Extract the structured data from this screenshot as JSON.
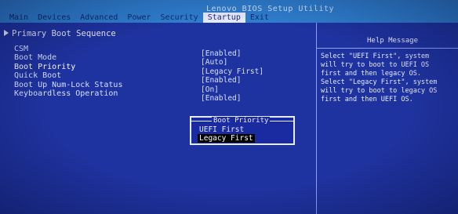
{
  "window": {
    "title": "Lenovo BIOS Setup Utility"
  },
  "menu": [
    {
      "label": "Main"
    },
    {
      "label": "Devices"
    },
    {
      "label": "Advanced"
    },
    {
      "label": "Power"
    },
    {
      "label": "Security"
    },
    {
      "label": "Startup"
    },
    {
      "label": "Exit"
    }
  ],
  "active_menu": "Startup",
  "main": {
    "section_title": "Primary Boot Sequence",
    "settings": [
      {
        "label": "CSM",
        "value": "[Enabled]"
      },
      {
        "label": "Boot Mode",
        "value": "[Auto]"
      },
      {
        "label": "Boot Priority",
        "value": "[Legacy First]"
      },
      {
        "label": "Quick Boot",
        "value": "[Enabled]"
      },
      {
        "label": "Boot Up Num-Lock Status",
        "value": "[On]"
      },
      {
        "label": "Keyboardless Operation",
        "value": "[Enabled]"
      }
    ]
  },
  "popup": {
    "title": "Boot Priority",
    "options": [
      "UEFI First",
      "Legacy First"
    ],
    "selected": "Legacy First"
  },
  "help": {
    "title": "Help Message",
    "lines": [
      "Select \"UEFI First\", system",
      "will try to boot to UEFI OS",
      "first and then legacy OS.",
      "Select \"Legacy First\", system",
      "will try to boot to legacy OS",
      "first and then UEFI OS."
    ]
  },
  "colors": {
    "background": "#1f33a0",
    "menu_bar": "#2f7fd0",
    "text": "#e8ecff",
    "selected_bg": "#000000"
  }
}
